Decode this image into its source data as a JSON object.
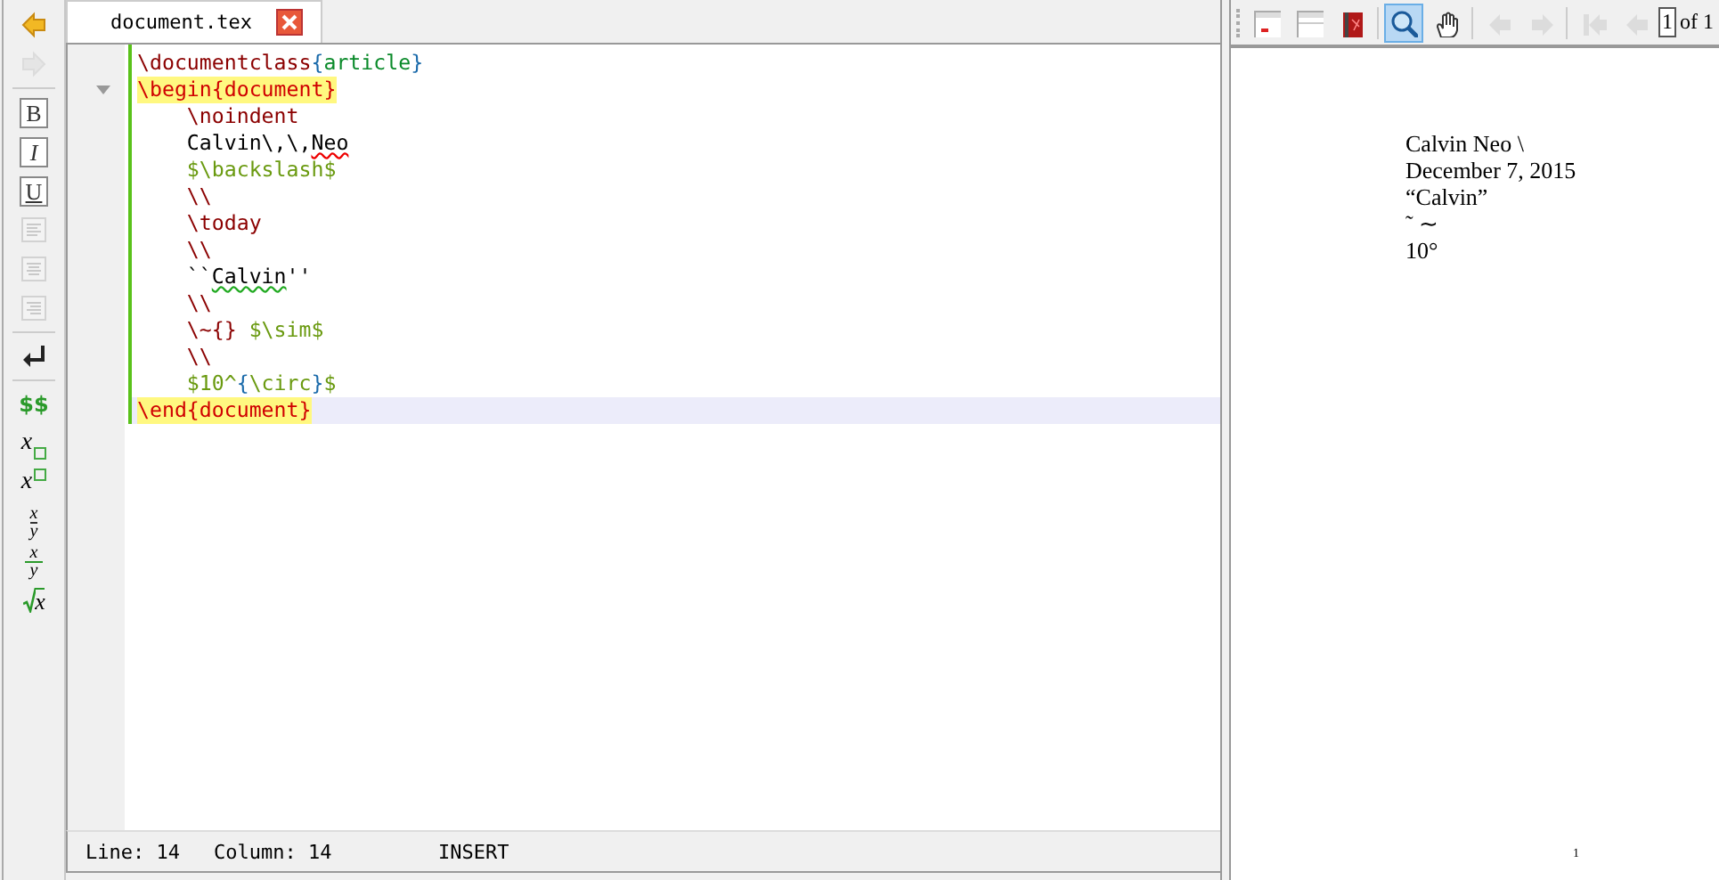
{
  "left_toolbar": [
    {
      "kind": "back",
      "disabled": false
    },
    {
      "kind": "forward",
      "disabled": true
    },
    {
      "kind": "sep"
    },
    {
      "kind": "bold",
      "label": "B"
    },
    {
      "kind": "italic",
      "label": "I"
    },
    {
      "kind": "underline",
      "label": "U"
    },
    {
      "kind": "align-left",
      "disabled": true
    },
    {
      "kind": "align-center",
      "disabled": true
    },
    {
      "kind": "align-right",
      "disabled": true
    },
    {
      "kind": "sep"
    },
    {
      "kind": "return",
      "disabled": false
    },
    {
      "kind": "sep"
    },
    {
      "kind": "math",
      "label": "$$"
    },
    {
      "kind": "sub",
      "label": "x"
    },
    {
      "kind": "sup",
      "label": "x"
    },
    {
      "kind": "frac",
      "num": "x",
      "den": "y"
    },
    {
      "kind": "dfrac",
      "num": "x",
      "den": "y"
    },
    {
      "kind": "sqrt",
      "label": "x"
    }
  ],
  "tabs": [
    {
      "label": "document.tex",
      "selected": true
    }
  ],
  "editor": {
    "lines": [
      {
        "env": false,
        "foldable": false,
        "current": false,
        "tokens": [
          {
            "kind": "cmd",
            "text": "\\documentclass"
          },
          {
            "kind": "brace",
            "text": "{"
          },
          {
            "kind": "arg",
            "text": "article"
          },
          {
            "kind": "brace",
            "text": "}"
          }
        ]
      },
      {
        "env": true,
        "foldable": true,
        "current": false,
        "tokens": [
          {
            "kind": "env",
            "text": "\\begin{document}"
          }
        ]
      },
      {
        "env": false,
        "foldable": false,
        "current": false,
        "tokens": [
          {
            "kind": "cmd",
            "text": "    \\noindent"
          }
        ]
      },
      {
        "env": false,
        "foldable": false,
        "current": false,
        "tokens": [
          {
            "kind": "text",
            "text": "    Calvin\\,\\,"
          },
          {
            "kind": "spell",
            "text": "Neo"
          }
        ]
      },
      {
        "env": false,
        "foldable": false,
        "current": false,
        "tokens": [
          {
            "kind": "math",
            "text": "    $\\backslash$"
          }
        ]
      },
      {
        "env": false,
        "foldable": false,
        "current": false,
        "tokens": [
          {
            "kind": "cmd",
            "text": "    \\\\"
          }
        ]
      },
      {
        "env": false,
        "foldable": false,
        "current": false,
        "tokens": [
          {
            "kind": "cmd",
            "text": "    \\today"
          }
        ]
      },
      {
        "env": false,
        "foldable": false,
        "current": false,
        "tokens": [
          {
            "kind": "cmd",
            "text": "    \\\\"
          }
        ]
      },
      {
        "env": false,
        "foldable": false,
        "current": false,
        "tokens": [
          {
            "kind": "text",
            "text": "    ``"
          },
          {
            "kind": "grammar",
            "text": "Calvin"
          },
          {
            "kind": "text",
            "text": "''"
          }
        ]
      },
      {
        "env": false,
        "foldable": false,
        "current": false,
        "tokens": [
          {
            "kind": "cmd",
            "text": "    \\\\"
          }
        ]
      },
      {
        "env": false,
        "foldable": false,
        "current": false,
        "tokens": [
          {
            "kind": "cmd",
            "text": "    \\~{}"
          },
          {
            "kind": "math",
            "text": " $\\sim$"
          }
        ]
      },
      {
        "env": false,
        "foldable": false,
        "current": false,
        "tokens": [
          {
            "kind": "cmd",
            "text": "    \\\\"
          }
        ]
      },
      {
        "env": false,
        "foldable": false,
        "current": false,
        "tokens": [
          {
            "kind": "math",
            "text": "    $10^"
          },
          {
            "kind": "brace",
            "text": "{"
          },
          {
            "kind": "math",
            "text": "\\circ"
          },
          {
            "kind": "brace",
            "text": "}"
          },
          {
            "kind": "math",
            "text": "$"
          }
        ]
      },
      {
        "env": true,
        "foldable": false,
        "current": true,
        "tokens": [
          {
            "kind": "env",
            "text": "\\end{document}"
          }
        ]
      }
    ]
  },
  "status_bar": {
    "line": "Line: 14",
    "column": "Column: 14",
    "mode": "INSERT"
  },
  "preview_toolbar": [
    {
      "kind": "window-red",
      "selected": false,
      "disabled": false
    },
    {
      "kind": "window",
      "selected": false,
      "disabled": false
    },
    {
      "kind": "book",
      "selected": false,
      "disabled": false
    },
    {
      "kind": "sep"
    },
    {
      "kind": "zoom",
      "selected": true,
      "disabled": false
    },
    {
      "kind": "hand",
      "selected": false,
      "disabled": false
    },
    {
      "kind": "sep"
    },
    {
      "kind": "prev",
      "selected": false,
      "disabled": true
    },
    {
      "kind": "next",
      "selected": false,
      "disabled": true
    },
    {
      "kind": "sep"
    },
    {
      "kind": "first",
      "selected": false,
      "disabled": true
    },
    {
      "kind": "prev",
      "selected": false,
      "disabled": true
    },
    {
      "kind": "page",
      "value": "1",
      "total": "of 1"
    }
  ],
  "preview": {
    "lines": [
      "Calvin Neo \\",
      "December 7, 2015",
      "“Calvin”",
      "˜ ∼",
      "10°"
    ],
    "page_number": "1"
  }
}
